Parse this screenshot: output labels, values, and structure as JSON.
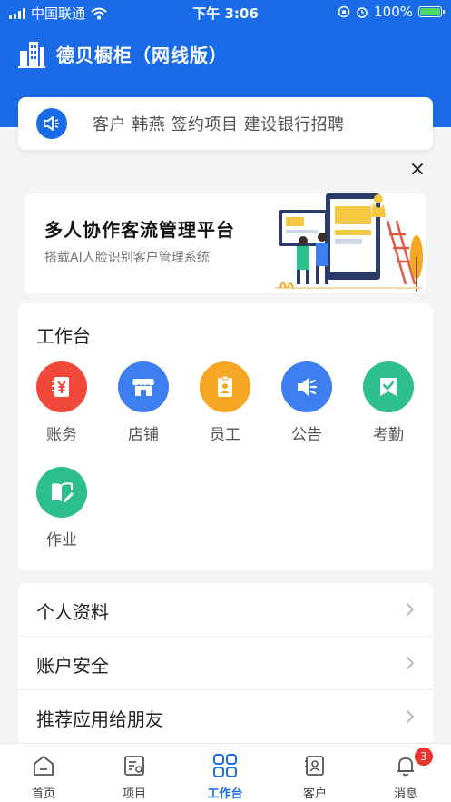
{
  "status_bar": {
    "carrier": "中国联通",
    "time": "下午 3:06",
    "battery": "100%"
  },
  "app": {
    "title": "德贝橱柜（网线版）"
  },
  "notice": {
    "text": "客户 韩燕 签约项目 建设银行招聘"
  },
  "banner": {
    "title": "多人协作客流管理平台",
    "subtitle": "搭载AI人脸识别客户管理系统",
    "close": "×"
  },
  "workspace": {
    "title": "工作台",
    "items": [
      {
        "label": "账务",
        "icon": "finance-icon",
        "color": "#f0493a"
      },
      {
        "label": "店铺",
        "icon": "store-icon",
        "color": "#3d7ef0"
      },
      {
        "label": "员工",
        "icon": "employee-badge-icon",
        "color": "#f5a623"
      },
      {
        "label": "公告",
        "icon": "megaphone-icon",
        "color": "#3d7ef0"
      },
      {
        "label": "考勤",
        "icon": "attendance-check-icon",
        "color": "#2dbf8c"
      },
      {
        "label": "作业",
        "icon": "homework-book-icon",
        "color": "#2dbf8c"
      }
    ]
  },
  "menu": {
    "items": [
      {
        "label": "个人资料"
      },
      {
        "label": "账户安全"
      },
      {
        "label": "推荐应用给朋友"
      }
    ]
  },
  "tabbar": {
    "items": [
      {
        "label": "首页",
        "icon": "home-icon"
      },
      {
        "label": "项目",
        "icon": "project-icon"
      },
      {
        "label": "工作台",
        "icon": "workbench-grid-icon",
        "active": true
      },
      {
        "label": "客户",
        "icon": "customer-icon"
      },
      {
        "label": "消息",
        "icon": "bell-icon",
        "badge": "3"
      }
    ]
  },
  "colors": {
    "primary": "#1a6be8",
    "badge": "#e8332f"
  }
}
